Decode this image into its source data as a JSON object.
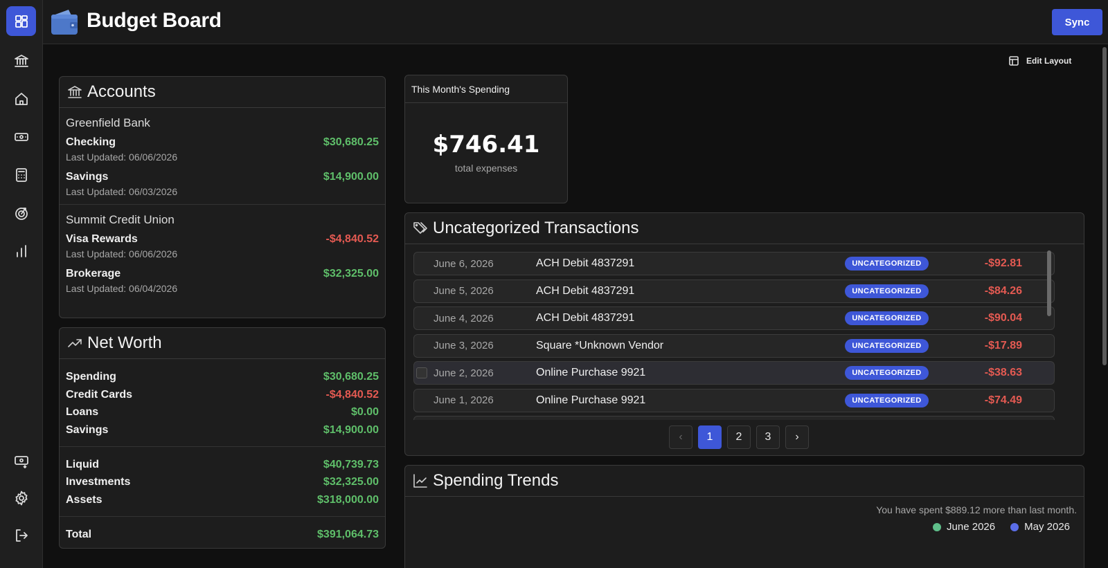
{
  "app": {
    "title": "Budget Board",
    "sync_label": "Sync"
  },
  "sidebar": {
    "items": [
      {
        "name": "dashboard",
        "icon": "dashboard-icon",
        "active": true
      },
      {
        "name": "accounts",
        "icon": "bank-icon"
      },
      {
        "name": "home",
        "icon": "home-icon"
      },
      {
        "name": "transactions",
        "icon": "banknote-icon"
      },
      {
        "name": "budgets",
        "icon": "calculator-icon"
      },
      {
        "name": "goals",
        "icon": "goal-icon"
      },
      {
        "name": "trends",
        "icon": "bar-chart-icon"
      },
      {
        "name": "import",
        "icon": "money-import-icon"
      },
      {
        "name": "settings",
        "icon": "gear-icon"
      },
      {
        "name": "logout",
        "icon": "logout-icon"
      }
    ]
  },
  "toolbar": {
    "edit_layout_label": "Edit Layout"
  },
  "accounts": {
    "title": "Accounts",
    "groups": [
      {
        "bank": "Greenfield Bank",
        "items": [
          {
            "name": "Checking",
            "amount": "$30,680.25",
            "updated": "Last Updated: 06/06/2026"
          },
          {
            "name": "Savings",
            "amount": "$14,900.00",
            "updated": "Last Updated: 06/03/2026"
          }
        ]
      },
      {
        "bank": "Summit Credit Union",
        "items": [
          {
            "name": "Visa Rewards",
            "amount": "-$4,840.52",
            "updated": "Last Updated: 06/06/2026"
          },
          {
            "name": "Brokerage",
            "amount": "$32,325.00",
            "updated": "Last Updated: 06/04/2026"
          }
        ]
      }
    ]
  },
  "net_worth": {
    "title": "Net Worth",
    "sections": [
      [
        {
          "label": "Spending",
          "value": "$30,680.25"
        },
        {
          "label": "Credit Cards",
          "value": "-$4,840.52"
        },
        {
          "label": "Loans",
          "value": "$0.00"
        },
        {
          "label": "Savings",
          "value": "$14,900.00"
        }
      ],
      [
        {
          "label": "Liquid",
          "value": "$40,739.73"
        },
        {
          "label": "Investments",
          "value": "$32,325.00"
        },
        {
          "label": "Assets",
          "value": "$318,000.00"
        }
      ],
      [
        {
          "label": "Total",
          "value": "$391,064.73"
        }
      ]
    ]
  },
  "spending": {
    "title": "This Month's Spending",
    "amount": "$746.41",
    "caption": "total expenses"
  },
  "uncategorized": {
    "title": "Uncategorized Transactions",
    "badge": "UNCATEGORIZED",
    "rows": [
      {
        "date": "June 6, 2026",
        "desc": "ACH Debit 4837291",
        "amount": "-$92.81"
      },
      {
        "date": "June 5, 2026",
        "desc": "ACH Debit 4837291",
        "amount": "-$84.26"
      },
      {
        "date": "June 4, 2026",
        "desc": "ACH Debit 4837291",
        "amount": "-$90.04"
      },
      {
        "date": "June 3, 2026",
        "desc": "Square *Unknown Vendor",
        "amount": "-$17.89"
      },
      {
        "date": "June 2, 2026",
        "desc": "Online Purchase 9921",
        "amount": "-$38.63"
      },
      {
        "date": "June 1, 2026",
        "desc": "Online Purchase 9921",
        "amount": "-$74.49"
      }
    ],
    "pages": [
      "1",
      "2",
      "3"
    ],
    "current_page": "1"
  },
  "trends": {
    "title": "Spending Trends",
    "note": "You have spent $889.12 more than last month.",
    "legend": [
      {
        "label": "June 2026",
        "color": "#5fbf8a"
      },
      {
        "label": "May 2026",
        "color": "#5b6ee8"
      }
    ]
  },
  "colors": {
    "accent": "#3e57d8",
    "positive": "#5fbf6a",
    "negative": "#e45a52"
  }
}
